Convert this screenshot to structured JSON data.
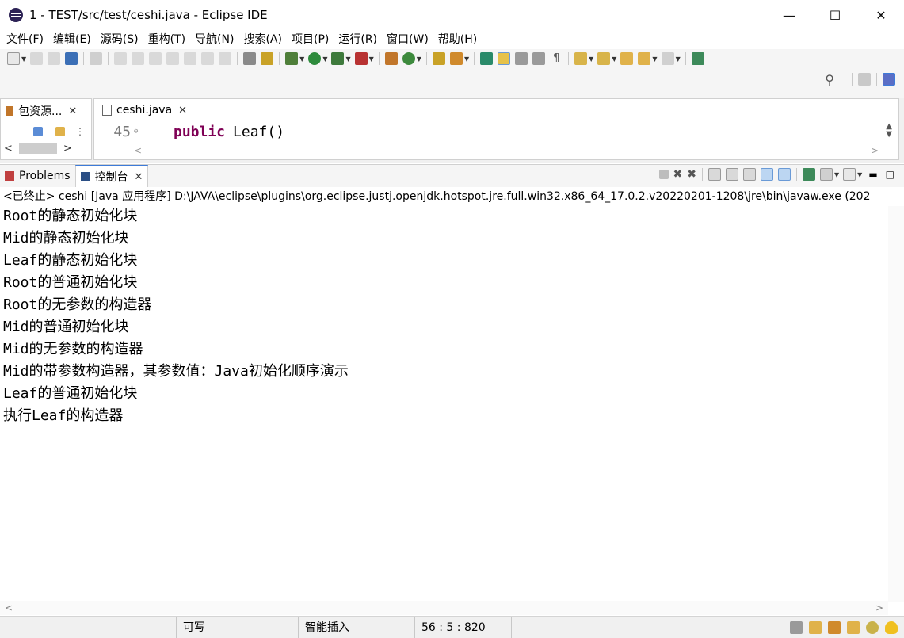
{
  "window": {
    "title": "1 - TEST/src/test/ceshi.java - Eclipse IDE"
  },
  "menu": [
    "文件(F)",
    "编辑(E)",
    "源码(S)",
    "重构(T)",
    "导航(N)",
    "搜索(A)",
    "项目(P)",
    "运行(R)",
    "窗口(W)",
    "帮助(H)"
  ],
  "package_explorer": {
    "tab_label": "包资源..."
  },
  "editor": {
    "tab_label": "ceshi.java",
    "line_number": "45",
    "code_keyword": "public",
    "code_rest": "Leaf()"
  },
  "console": {
    "tabs": {
      "problems": "Problems",
      "console": "控制台"
    },
    "process_line": "<已终止> ceshi [Java 应用程序] D:\\JAVA\\eclipse\\plugins\\org.eclipse.justj.openjdk.hotspot.jre.full.win32.x86_64_17.0.2.v20220201-1208\\jre\\bin\\javaw.exe  (202",
    "output": [
      "Root的静态初始化块",
      "Mid的静态初始化块",
      "Leaf的静态初始化块",
      "Root的普通初始化块",
      "Root的无参数的构造器",
      "Mid的普通初始化块",
      "Mid的无参数的构造器",
      "Mid的带参数构造器，其参数值：Java初始化顺序演示",
      "Leaf的普通初始化块",
      "执行Leaf的构造器"
    ]
  },
  "status_bar": {
    "writable": "可写",
    "insert_mode": "智能插入",
    "position": "56 : 5 : 820"
  }
}
